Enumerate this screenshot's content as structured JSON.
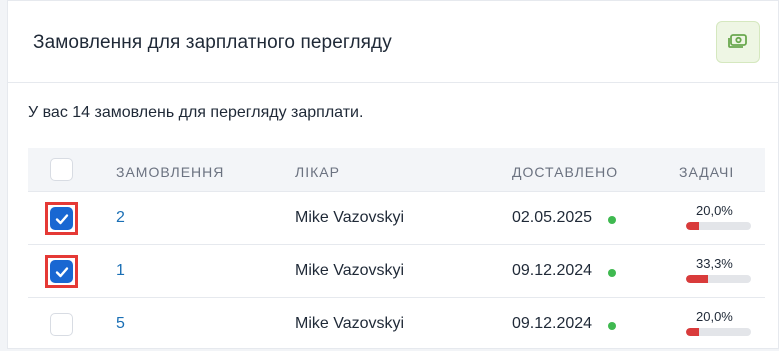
{
  "card": {
    "title": "Замовлення для зарплатного перегляду",
    "summary": "У вас 14 замовлень для перегляду зарплати.",
    "action_icon": "money-icon",
    "accent_color": "#6aa84f"
  },
  "table": {
    "columns": [
      "ЗАМОВЛЕННЯ",
      "ЛІКАР",
      "ДОСТАВЛЕНО",
      "ЗАДАЧІ"
    ],
    "rows": [
      {
        "checked": true,
        "order": "2",
        "doctor": "Mike Vazovskyi",
        "delivered": "02.05.2025",
        "status_color": "#3fb950",
        "tasks_label": "20,0%",
        "tasks_progress": 0.2
      },
      {
        "checked": true,
        "order": "1",
        "doctor": "Mike Vazovskyi",
        "delivered": "09.12.2024",
        "status_color": "#3fb950",
        "tasks_label": "33,3%",
        "tasks_progress": 0.333
      },
      {
        "checked": false,
        "order": "5",
        "doctor": "Mike Vazovskyi",
        "delivered": "09.12.2024",
        "status_color": "#3fb950",
        "tasks_label": "20,0%",
        "tasks_progress": 0.2
      }
    ]
  },
  "colors": {
    "checkbox_checked": "#1967d2",
    "link": "#1a6fb5",
    "progress_fill": "#d93b3b",
    "highlight": "#e53935"
  }
}
